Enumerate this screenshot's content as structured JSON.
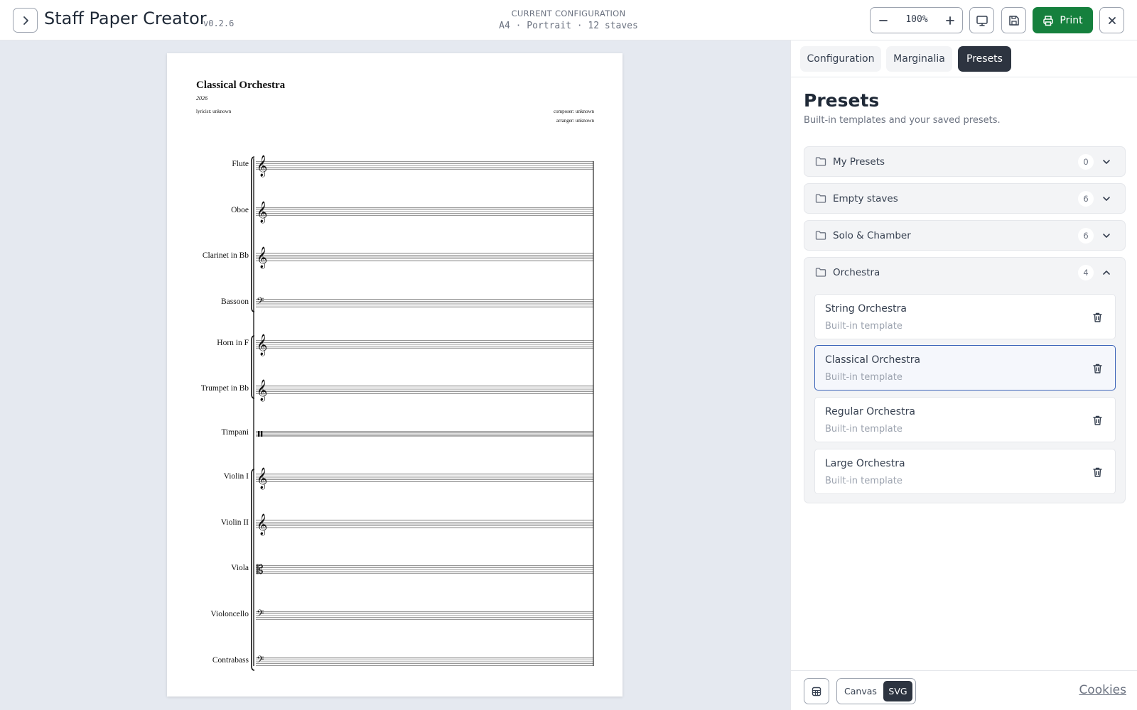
{
  "header": {
    "title": "Staff Paper Creator",
    "version": "v0.2.6",
    "config_label": "CURRENT CONFIGURATION",
    "config_value": "A4 · Portrait · 12 staves",
    "zoom": "100%",
    "print_label": "Print"
  },
  "score": {
    "title": "Classical Orchestra",
    "year": "2026",
    "lyricist": "lyricist: unknown",
    "composer": "composer: unknown",
    "arranger": "arranger: unknown",
    "instruments": [
      {
        "name": "Flute",
        "clef": "treble"
      },
      {
        "name": "Oboe",
        "clef": "treble"
      },
      {
        "name": "Clarinet in Bb",
        "clef": "treble"
      },
      {
        "name": "Bassoon",
        "clef": "bass"
      },
      {
        "name": "Horn in F",
        "clef": "treble"
      },
      {
        "name": "Trumpet in Bb",
        "clef": "treble"
      },
      {
        "name": "Timpani",
        "clef": "percussion"
      },
      {
        "name": "Violin I",
        "clef": "treble"
      },
      {
        "name": "Violin II",
        "clef": "treble"
      },
      {
        "name": "Viola",
        "clef": "alto"
      },
      {
        "name": "Violoncello",
        "clef": "bass"
      },
      {
        "name": "Contrabass",
        "clef": "bass"
      }
    ]
  },
  "panel": {
    "tabs": [
      {
        "label": "Configuration",
        "active": false
      },
      {
        "label": "Marginalia",
        "active": false
      },
      {
        "label": "Presets",
        "active": true
      }
    ],
    "title": "Presets",
    "subtitle": "Built-in templates and your saved presets.",
    "groups": [
      {
        "label": "My Presets",
        "count": "0",
        "expanded": false
      },
      {
        "label": "Empty staves",
        "count": "6",
        "expanded": false
      },
      {
        "label": "Solo & Chamber",
        "count": "6",
        "expanded": false
      },
      {
        "label": "Orchestra",
        "count": "4",
        "expanded": true
      }
    ],
    "presets": [
      {
        "name": "String Orchestra",
        "type": "Built-in template",
        "selected": false
      },
      {
        "name": "Classical Orchestra",
        "type": "Built-in template",
        "selected": true
      },
      {
        "name": "Regular Orchestra",
        "type": "Built-in template",
        "selected": false
      },
      {
        "name": "Large Orchestra",
        "type": "Built-in template",
        "selected": false
      }
    ]
  },
  "footer": {
    "engine_options": [
      "Canvas",
      "SVG"
    ],
    "engine_selected": "SVG",
    "cookies_label": "Cookies"
  },
  "colors": {
    "print_button": "#15803d",
    "active_tab": "#2d3440",
    "selected_border": "#3b63b8",
    "canvas_background": "#e5e9f0"
  },
  "icons": [
    "chevron-right-icon",
    "minus-icon",
    "plus-icon",
    "monitor-icon",
    "save-icon",
    "printer-icon",
    "close-icon",
    "folder-icon",
    "chevron-down-icon",
    "chevron-up-icon",
    "trash-icon",
    "ruler-icon"
  ]
}
